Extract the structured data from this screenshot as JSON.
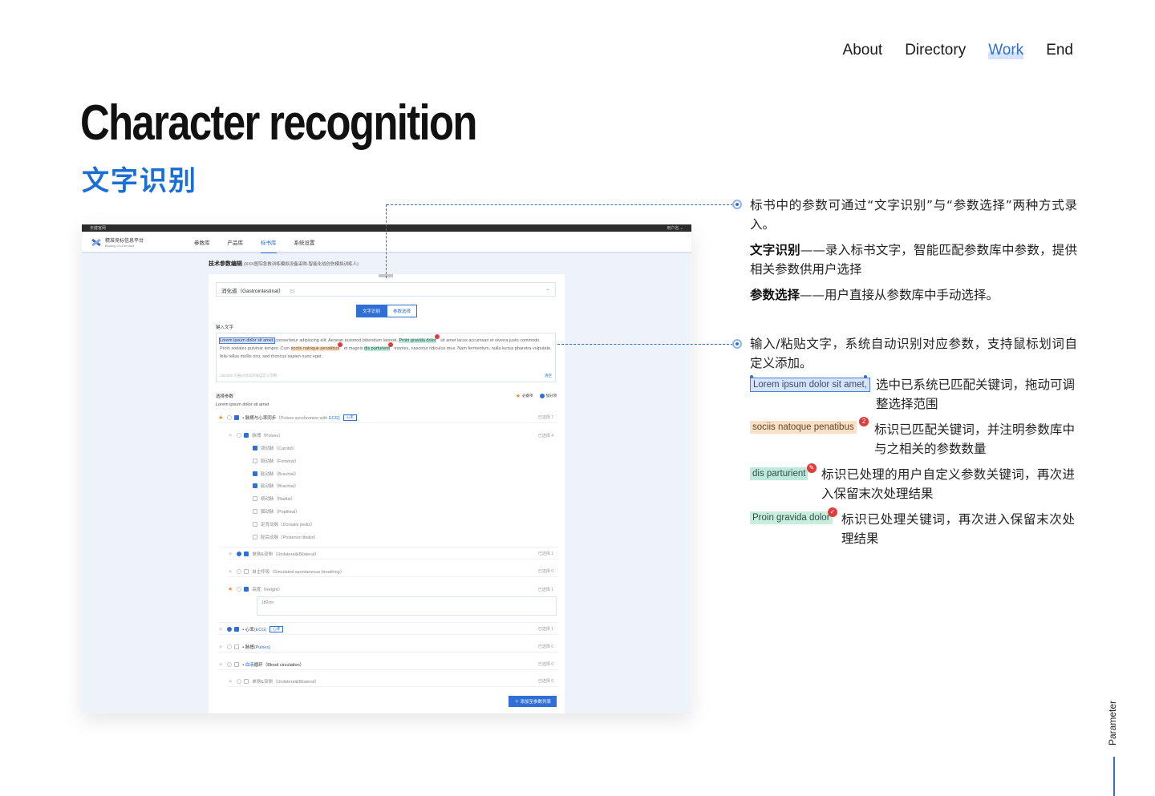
{
  "nav": [
    "About",
    "Directory",
    "Work",
    "End"
  ],
  "title": "Character recognition",
  "subtitle": "文字识别",
  "mock": {
    "top_left": "天健官网",
    "top_right": "用户名 ⌄",
    "logo_main": "精准竞标信息平台",
    "logo_sub": "Bidding On-Demand",
    "tabs": [
      "参数库",
      "产品库",
      "标书库",
      "系统设置"
    ],
    "section_title": "技术参数编辑",
    "section_sub": "(XXX医院急救训练模拟设备采购-智能化战创伤模拟训练人)",
    "select_value": "消化道（Gastrointestinal）",
    "select_count": "(5)",
    "seg": [
      "文字识别",
      "参数选择"
    ],
    "input_label": "键入文字",
    "text_pieces": [
      "Lorem ipsum dolor sit amet,",
      " consectetur adipiscing elit. Aenean euismod bibendum laoreet. ",
      "Proin gravida dolor",
      " sit amet lacus accumsan et viverra justo commodo. Proin sodales pulvinar tempor. Cum ",
      "sociis natoque penatibus",
      " et magnis ",
      "dis parturient",
      " montes, nascetur ridiculus mus. Nam fermentum, nulla luctus pharetra vulputate, felis tellus mollis orci, sed rhoncus sapien nunc eget."
    ],
    "text_foot": "180/200   可通过划词添加自定义参数",
    "clear": "清空",
    "param_label": "选择参数",
    "param_sub": "Lorem ipsum dolor sit amet",
    "legend_required": "必备项",
    "legend_bonus": "加分项",
    "rows": [
      {
        "text": "• 脉搏与心率同步",
        "en": "（Pulses synchronize with ",
        "blue": "ECG)",
        "tag": "心率",
        "count": "已选择 7"
      },
      {
        "text": "脉搏",
        "en": "（Pulses）",
        "count": "已选择 4"
      },
      {
        "text": "颈动脉",
        "en": "（Carotid）"
      },
      {
        "text": "股动脉",
        "en": "（Femoral）"
      },
      {
        "text": "肱动脉",
        "en": "（Brachial）"
      },
      {
        "text": "肱动脉",
        "en": "（Brachial）"
      },
      {
        "text": "桡动脉",
        "en": "（Radial）"
      },
      {
        "text": "腘动脉",
        "en": "（Popliteal）"
      },
      {
        "text": "足背动脉",
        "en": "（Dorsalis pedis）"
      },
      {
        "text": "胫后动脉",
        "en": "（Posterior tibialis）"
      },
      {
        "text": "单侧&双侧",
        "en": "（Unilateral&Bilateral）",
        "count": "已选择 1"
      },
      {
        "text": "自主呼吸",
        "en": "（Simulated spontaneous breathing）",
        "count": "已选择 0"
      },
      {
        "text": "高度",
        "en": "（Height）",
        "count": "已选择 1"
      },
      {
        "text": "• 心率",
        "en": "",
        "blue": "(ECG)",
        "tag": "心率",
        "count": "已选择 1"
      },
      {
        "text": "• 脉搏",
        "en": "",
        "blue": "(Pulses)",
        "count": "已选择 0"
      },
      {
        "text": "• ",
        "en": "循环（Blood circulation）",
        "blue": "血液",
        "count": "已选择 0"
      },
      {
        "text": "单侧&双侧",
        "en": "（Unilateral&Bilateral）",
        "count": "已选择 0"
      }
    ],
    "height_value": "180cm",
    "add_button": "＋ 添加至参数列表"
  },
  "annotations": {
    "a1": "标书中的参数可通过“文字识别”与“参数选择”两种方式录入。",
    "a2_bold": "文字识别",
    "a2": "——录入标书文字，智能匹配参数库中参数，提供相关参数供用户选择",
    "a3_bold": "参数选择",
    "a3": "——用户直接从参数库中手动选择。",
    "a4": "输入/粘贴文字，系统自动识别对应参数，支持鼠标划词自定义添加。",
    "k1": "Lorem ipsum dolor sit amet,",
    "k1_desc": "选中已系统已匹配关键词，拖动可调整选择范围",
    "k2": "sociis natoque penatibus",
    "k2_badge": "2",
    "k2_desc": "标识已匹配关键词，并注明参数库中与之相关的参数数量",
    "k3": "dis parturient",
    "k3_desc": "标识已处理的用户自定义参数关键词，再次进入保留末次处理结果",
    "k4": "Proin gravida dolor",
    "k4_desc": "标识已处理关键词，再次进入保留末次处理结果"
  },
  "side_label": "Parameter",
  "colors": {
    "accent": "#2f6fd6",
    "badge": "#e23b3b",
    "orange_hl": "#fbe0c5",
    "teal_hl": "#bfe9dd"
  }
}
